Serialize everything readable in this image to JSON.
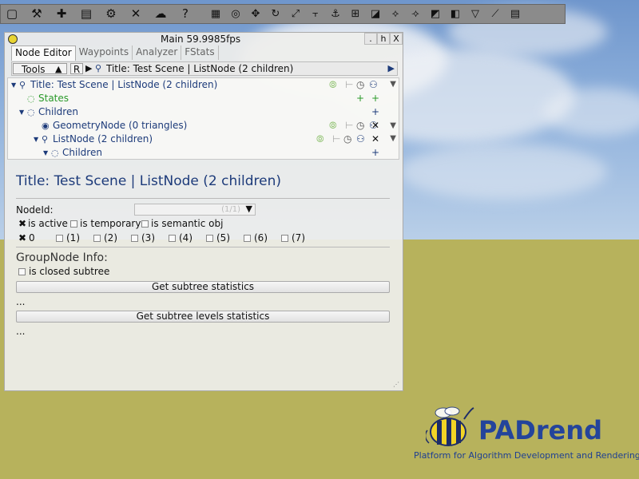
{
  "app": {
    "title": "Main 59.9985fps",
    "controls": [
      ".",
      "h",
      "X"
    ]
  },
  "toolbar": {
    "buttons": [
      {
        "name": "open-folder-icon",
        "glyph": "▢"
      },
      {
        "name": "scene-tool-icon",
        "glyph": "⚒"
      },
      {
        "name": "plugin-icon",
        "glyph": "✚"
      },
      {
        "name": "list-icon",
        "glyph": "▤"
      },
      {
        "name": "gear-icon",
        "glyph": "⚙"
      },
      {
        "name": "tools-icon",
        "glyph": "✕"
      },
      {
        "name": "weather-icon",
        "glyph": "☁"
      },
      {
        "name": "help-icon",
        "glyph": "?"
      }
    ],
    "right_buttons": [
      {
        "name": "numpad-icon",
        "glyph": "▦"
      },
      {
        "name": "camera-icon",
        "glyph": "◎"
      },
      {
        "name": "move-icon",
        "glyph": "✥"
      },
      {
        "name": "rotate-icon",
        "glyph": "↻"
      },
      {
        "name": "scale-icon",
        "glyph": "⤢"
      },
      {
        "name": "snap-icon",
        "glyph": "⫟"
      },
      {
        "name": "anchor-icon",
        "glyph": "⚓"
      },
      {
        "name": "measure-icon",
        "glyph": "⊞"
      },
      {
        "name": "select-area-icon",
        "glyph": "◪"
      },
      {
        "name": "transform-icon",
        "glyph": "⟡"
      },
      {
        "name": "transform-local-icon",
        "glyph": "⟢"
      },
      {
        "name": "edit-mode-icon",
        "glyph": "◩"
      },
      {
        "name": "paint-icon",
        "glyph": "◧"
      },
      {
        "name": "cone-icon",
        "glyph": "▽"
      },
      {
        "name": "path-icon",
        "glyph": "⟋"
      },
      {
        "name": "notes-icon",
        "glyph": "▤"
      }
    ]
  },
  "tabs": [
    "Node Editor",
    "Waypoints",
    "Analyzer",
    "FStats"
  ],
  "tools": {
    "tools_label": "Tools",
    "up_glyph": "▲",
    "r_label": "R",
    "play_glyph": "▶",
    "path": "Title: Test Scene | ListNode (2 children)",
    "arrow_glyph": "▶"
  },
  "tree": [
    {
      "label": "Title: Test Scene | ListNode (2 children)",
      "color": "#1d3b7a",
      "indent": 0
    },
    {
      "label": "States",
      "color": "#2a9a2a",
      "indent": 1
    },
    {
      "label": "Children",
      "color": "#1d3b7a",
      "indent": 0
    },
    {
      "label": "GeometryNode (0 triangles)",
      "color": "#1d3b7a",
      "indent": 2
    },
    {
      "label": "ListNode (2 children)",
      "color": "#1d3b7a",
      "indent": 2
    },
    {
      "label": "Children",
      "color": "#1d3b7a",
      "indent": 3
    }
  ],
  "detail": {
    "title": "Title: Test Scene | ListNode (2 children)",
    "nodeid_label": "NodeId:",
    "nodeid_value": "(1/1)",
    "checks": [
      {
        "label": "is active",
        "checked": true
      },
      {
        "label": "is temporary",
        "checked": false
      },
      {
        "label": "is semantic obj",
        "checked": false
      }
    ],
    "layers": [
      {
        "label": "0",
        "checked": true
      },
      {
        "label": "(1)",
        "checked": false
      },
      {
        "label": "(2)",
        "checked": false
      },
      {
        "label": "(3)",
        "checked": false
      },
      {
        "label": "(4)",
        "checked": false
      },
      {
        "label": "(5)",
        "checked": false
      },
      {
        "label": "(6)",
        "checked": false
      },
      {
        "label": "(7)",
        "checked": false
      }
    ],
    "group_info": "GroupNode Info:",
    "closed_subtree": "is closed subtree",
    "btn_stats": "Get subtree statistics",
    "ellipsis1": "...",
    "btn_levels": "Get subtree levels statistics",
    "ellipsis2": "..."
  },
  "logo": {
    "word": "PADrend",
    "subtitle": "Platform for Algorithm Development and Rendering"
  }
}
